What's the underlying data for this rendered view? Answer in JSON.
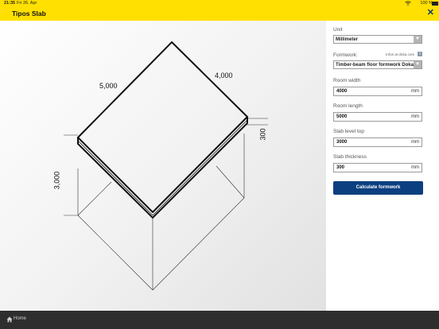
{
  "status_bar": {
    "time": "21:35",
    "date": "Fri 26. Apr",
    "battery": "100 %"
  },
  "app": {
    "title": "Tipos Slab"
  },
  "drawing": {
    "room_length_label": "5,000",
    "room_width_label": "4,000",
    "slab_level_label": "3,000",
    "slab_thickness_label": "300"
  },
  "panel": {
    "unit": {
      "label": "Unit",
      "value": "Millimeter"
    },
    "formwork": {
      "label": "Formwork:",
      "info_link": "Infos at doka.com",
      "info_icon": "i",
      "value": "Timber-beam floor formwork Dokaflex"
    },
    "room_width": {
      "label": "Room width",
      "value": "4000",
      "unit": "mm"
    },
    "room_length": {
      "label": "Room length",
      "value": "5000",
      "unit": "mm"
    },
    "slab_level_top": {
      "label": "Slab level top",
      "value": "3000",
      "unit": "mm"
    },
    "slab_thickness": {
      "label": "Slab thickness",
      "value": "300",
      "unit": "mm"
    },
    "calculate_button": "Calculate formwork"
  },
  "footer": {
    "home_label": "Home"
  },
  "colors": {
    "header": "#ffe000",
    "button": "#0b3f80",
    "footer": "#2e2e2e",
    "close_icon": "#0b3a72"
  },
  "icons": [
    "wifi-icon",
    "battery-icon",
    "close-icon",
    "info-icon",
    "chevron-down-icon",
    "home-icon"
  ]
}
